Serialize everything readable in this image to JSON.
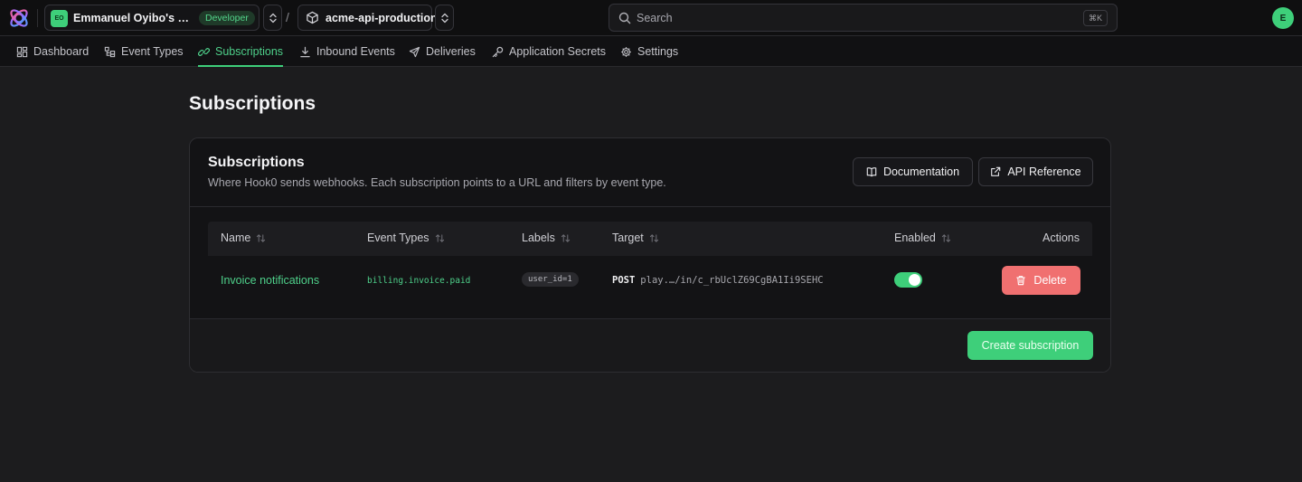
{
  "topbar": {
    "org_initials": "EO",
    "org_name": "Emmanuel Oyibo's per...",
    "org_badge": "Developer",
    "separator": "/",
    "app_name": "acme-api-production",
    "search_placeholder": "Search",
    "search_shortcut": "⌘K",
    "user_initial": "E"
  },
  "nav": {
    "tabs": [
      {
        "label": "Dashboard",
        "icon": "dashboard-icon"
      },
      {
        "label": "Event Types",
        "icon": "event-types-icon"
      },
      {
        "label": "Subscriptions",
        "icon": "link-icon",
        "active": true
      },
      {
        "label": "Inbound Events",
        "icon": "download-icon"
      },
      {
        "label": "Deliveries",
        "icon": "send-icon"
      },
      {
        "label": "Application Secrets",
        "icon": "key-icon"
      },
      {
        "label": "Settings",
        "icon": "gear-icon"
      }
    ]
  },
  "page": {
    "title": "Subscriptions"
  },
  "card": {
    "title": "Subscriptions",
    "description": "Where Hook0 sends webhooks. Each subscription points to a URL and filters by event type.",
    "documentation_label": "Documentation",
    "api_reference_label": "API Reference",
    "create_label": "Create subscription"
  },
  "table": {
    "headers": [
      "Name",
      "Event Types",
      "Labels",
      "Target",
      "Enabled",
      "Actions"
    ],
    "rows": [
      {
        "name": "Invoice notifications",
        "event_types": "billing.invoice.paid",
        "label": "user_id=1",
        "method": "POST",
        "target": "play.…/in/c_rbUclZ69CgBA1Ii9SEHC",
        "enabled": true,
        "action_label": "Delete"
      }
    ]
  },
  "colors": {
    "accent": "#3ecf7a",
    "danger": "#f07070",
    "background": "#1c1c1e"
  }
}
